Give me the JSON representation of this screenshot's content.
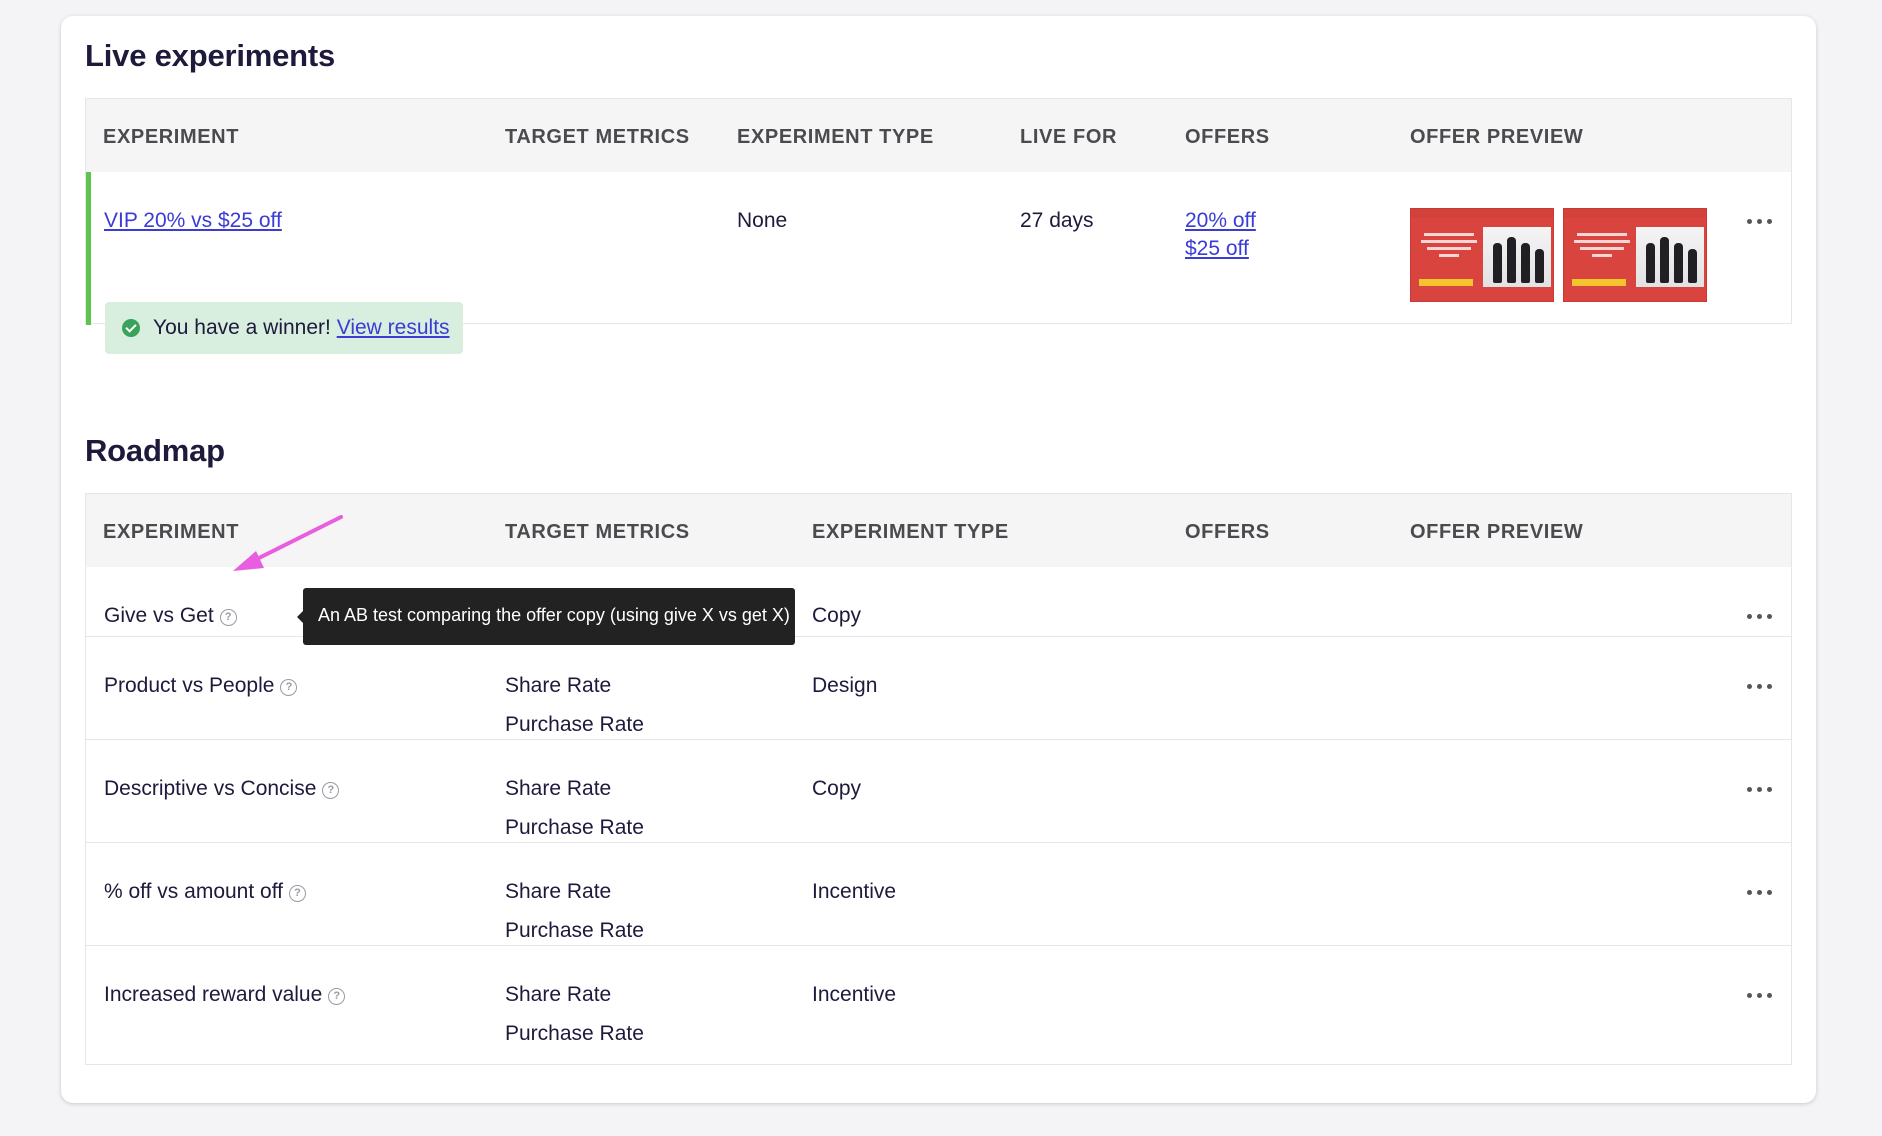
{
  "live": {
    "title": "Live experiments",
    "headers": {
      "experiment": "EXPERIMENT",
      "target_metrics": "TARGET METRICS",
      "experiment_type": "EXPERIMENT TYPE",
      "live_for": "LIVE FOR",
      "offers": "OFFERS",
      "offer_preview": "OFFER PREVIEW"
    },
    "row": {
      "name": "VIP 20% vs $25 off",
      "type": "None",
      "live_for": "27 days",
      "offers": [
        "20% off",
        "$25 off"
      ],
      "status_color": "#5cc44f",
      "winner_text": "You have a winner!",
      "winner_link": "View results"
    }
  },
  "roadmap": {
    "title": "Roadmap",
    "headers": {
      "experiment": "EXPERIMENT",
      "target_metrics": "TARGET METRICS",
      "experiment_type": "EXPERIMENT TYPE",
      "offers": "OFFERS",
      "offer_preview": "OFFER PREVIEW"
    },
    "rows": [
      {
        "name": "Give vs Get",
        "metrics": [],
        "type": "Copy"
      },
      {
        "name": "Product vs People",
        "metrics": [
          "Share Rate",
          "Purchase Rate"
        ],
        "type": "Design"
      },
      {
        "name": "Descriptive vs Concise",
        "metrics": [
          "Share Rate",
          "Purchase Rate"
        ],
        "type": "Copy"
      },
      {
        "name": "% off vs amount off",
        "metrics": [
          "Share Rate",
          "Purchase Rate"
        ],
        "type": "Incentive"
      },
      {
        "name": "Increased reward value",
        "metrics": [
          "Share Rate",
          "Purchase Rate"
        ],
        "type": "Incentive"
      }
    ],
    "tooltip": "An AB test comparing the offer copy (using give X vs get X)"
  },
  "colors": {
    "accent_link": "#3b3bd6",
    "annotation_arrow": "#e95ee0",
    "winner_bg": "#d8eedf",
    "preview_red": "#d9453e"
  }
}
